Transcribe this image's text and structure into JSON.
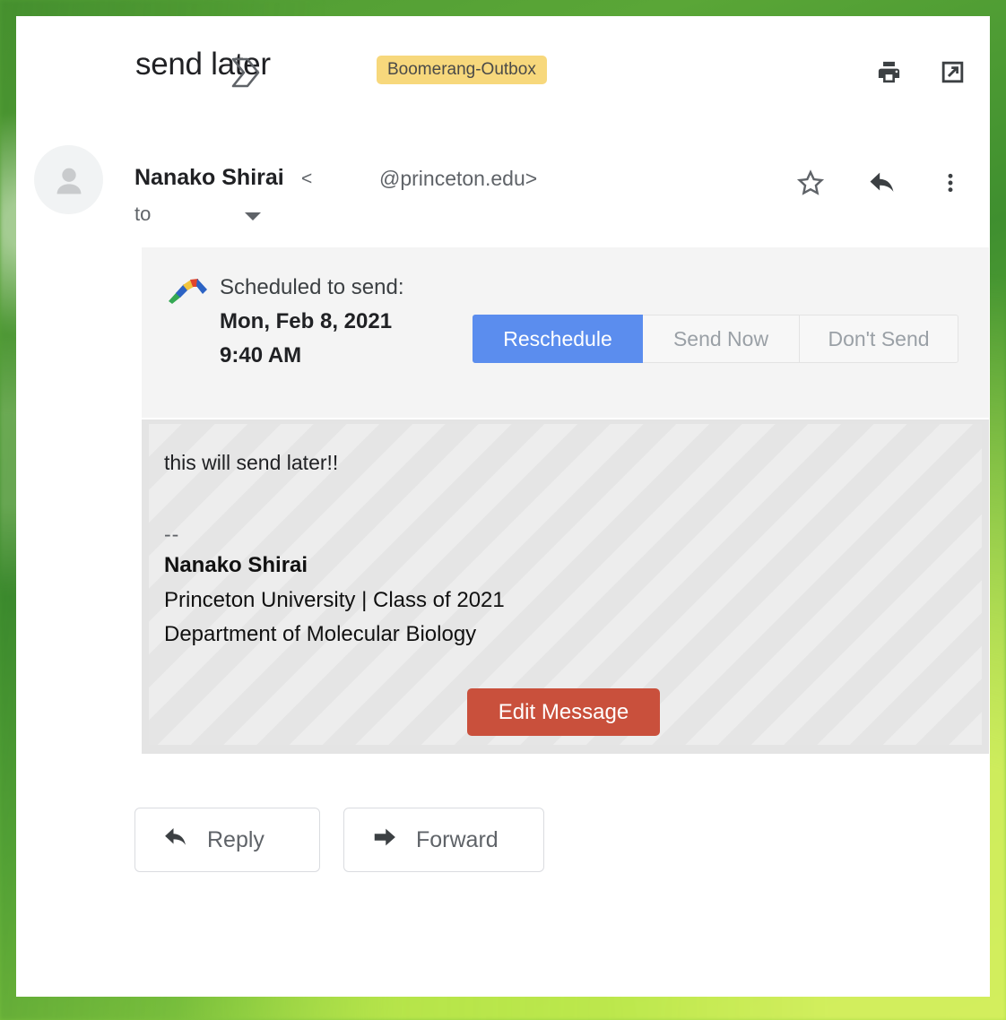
{
  "window": {
    "background_accent": "#4f9b33",
    "card_background": "#ffffff"
  },
  "subject": {
    "text": "send later",
    "boomerang_icon": "boomerang-outline-icon",
    "label_chip": "Boomerang-Outbox",
    "label_chip_color": "#f7d87c"
  },
  "header_actions": {
    "print": "print-icon",
    "popout": "open-in-new-icon"
  },
  "sender": {
    "avatar_icon": "person-avatar-icon",
    "name": "Nanako Shirai",
    "angle_open": "<",
    "email": "@princeton.edu>",
    "recipient_label": "to",
    "recipient_caret": "chevron-down-icon"
  },
  "message_actions": {
    "star": "star-outline-icon",
    "reply": "reply-arrow-icon",
    "more": "more-vertical-icon"
  },
  "schedule_banner": {
    "logo": "boomerang-color-logo",
    "prefix": "Scheduled to send: ",
    "datetime": "Mon, Feb 8, 2021 9:40 AM",
    "buttons": [
      {
        "label": "Reschedule",
        "state": "active",
        "color": "#5b8dee"
      },
      {
        "label": "Send Now",
        "state": "inactive"
      },
      {
        "label": "Don't Send",
        "state": "inactive"
      }
    ]
  },
  "body": {
    "line_1": "this will send later!!",
    "signature_separator": "--",
    "signature_name": "Nanako Shirai",
    "signature_line_2": "Princeton University | Class of 2021",
    "signature_line_3": "Department of Molecular Biology",
    "edit_button": "Edit Message",
    "edit_button_color": "#c9503c"
  },
  "footer": {
    "reply_label": "Reply",
    "reply_icon": "reply-arrow-icon",
    "forward_label": "Forward",
    "forward_icon": "forward-arrow-icon"
  }
}
